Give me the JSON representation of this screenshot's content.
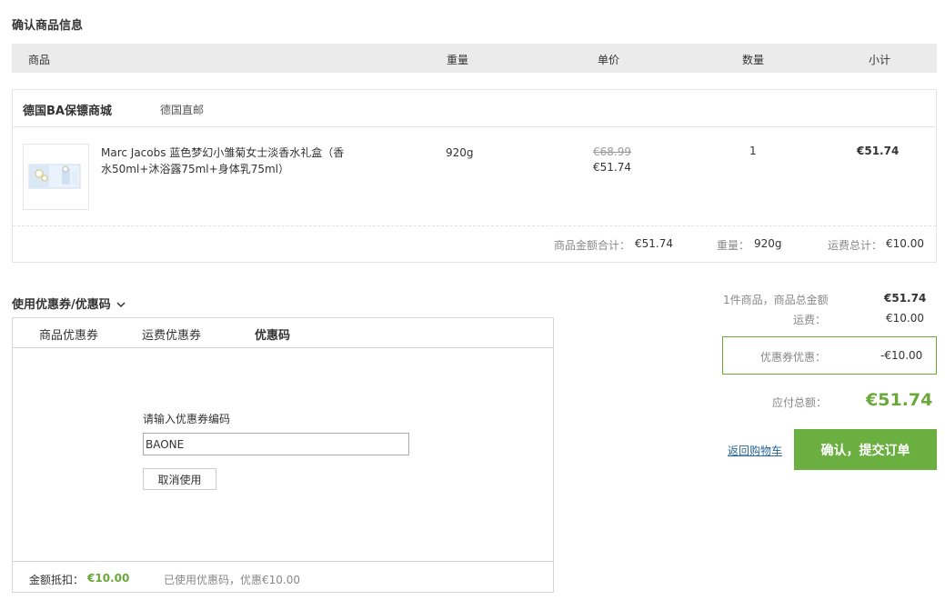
{
  "page": {
    "section_title": "确认商品信息"
  },
  "table_header": {
    "product": "商品",
    "weight": "重量",
    "unit_price": "单价",
    "quantity": "数量",
    "subtotal": "小计"
  },
  "store": {
    "name": "德国BA保镖商城",
    "shipping_method": "德国直邮",
    "items": [
      {
        "title": "Marc Jacobs 蓝色梦幻小雏菊女士淡香水礼盒（香水50ml+沐浴露75ml+身体乳75ml）",
        "image_icon": "perfume-gift-box-image",
        "weight": "920g",
        "original_price": "€68.99",
        "price": "€51.74",
        "quantity": "1",
        "subtotal": "€51.74"
      }
    ],
    "footer": {
      "goods_total_label": "商品金额合计：",
      "goods_total": "€51.74",
      "weight_label": "重量：",
      "weight": "920g",
      "shipping_total_label": "运费总计：",
      "shipping_total": "€10.00"
    }
  },
  "coupon": {
    "toggle_label": "使用优惠券/优惠码",
    "tabs": [
      "商品优惠券",
      "运费优惠券",
      "优惠码"
    ],
    "active_tab": 2,
    "input_label": "请输入优惠券编码",
    "input_value": "BAONE",
    "cancel_label": "取消使用",
    "deduction_label": "金额抵扣：",
    "deduction_value": "€10.00",
    "status_text": "已使用优惠码，优惠€10.00"
  },
  "summary": {
    "items_label": "1件商品，商品总金额",
    "items_total": "€51.74",
    "shipping_label": "运费：",
    "shipping": "€10.00",
    "discount_label": "优惠券优惠：",
    "discount": "-€10.00",
    "payable_label": "应付总额：",
    "payable": "€51.74",
    "back_label": "返回购物车",
    "submit_label": "确认，提交订单"
  },
  "colors": {
    "accent": "#6aaf3f",
    "link": "#2a6496",
    "header_bg": "#ebebeb"
  }
}
